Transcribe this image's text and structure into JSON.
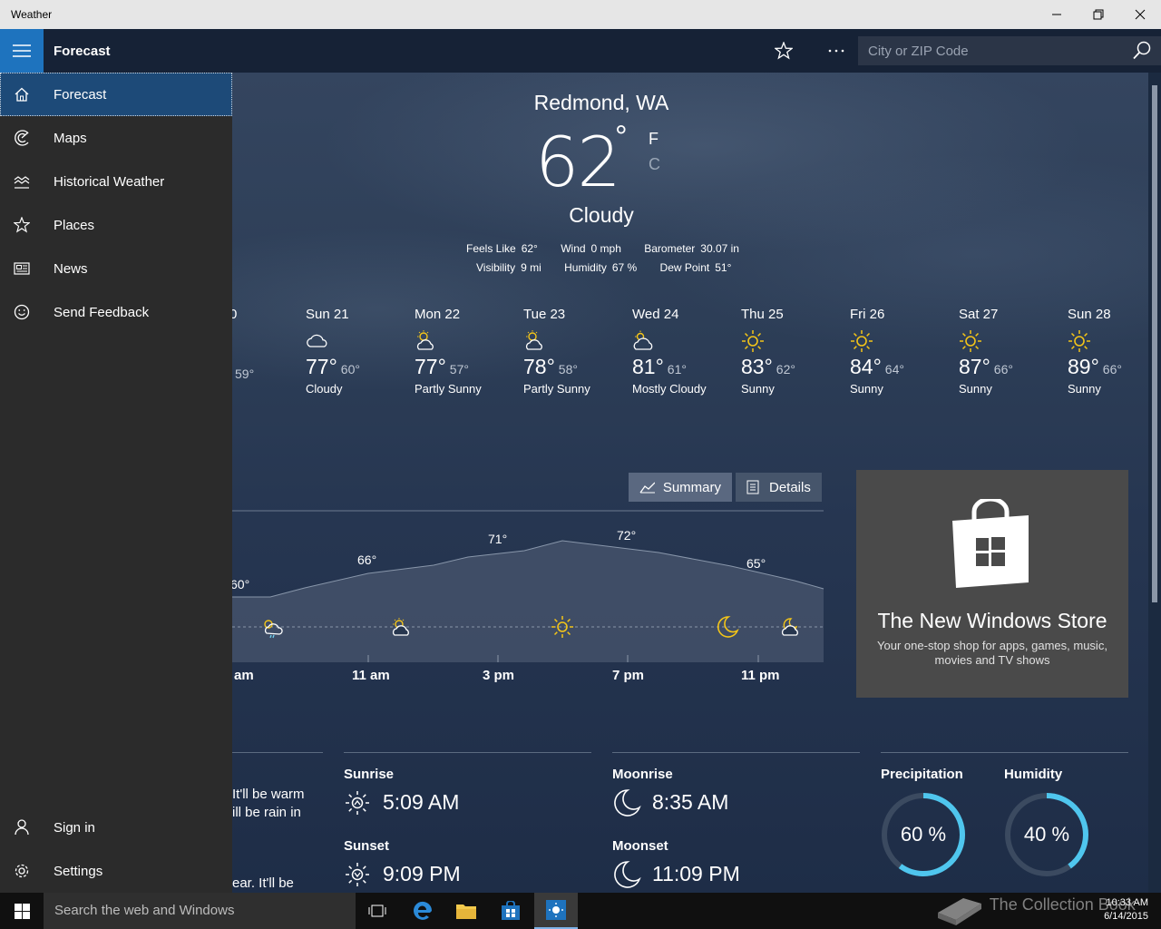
{
  "window": {
    "title": "Weather"
  },
  "header": {
    "title": "Forecast",
    "search_placeholder": "City or ZIP Code"
  },
  "sidebar": {
    "items": [
      {
        "label": "Forecast",
        "icon": "home-icon"
      },
      {
        "label": "Maps",
        "icon": "map-icon"
      },
      {
        "label": "Historical Weather",
        "icon": "chart-icon"
      },
      {
        "label": "Places",
        "icon": "star-icon"
      },
      {
        "label": "News",
        "icon": "news-icon"
      },
      {
        "label": "Send Feedback",
        "icon": "smiley-icon"
      }
    ],
    "bottom": [
      {
        "label": "Sign in",
        "icon": "person-icon"
      },
      {
        "label": "Settings",
        "icon": "gear-icon"
      }
    ]
  },
  "current": {
    "location": "Redmond, WA",
    "temp": "62",
    "degree": "°",
    "unit_f": "F",
    "unit_c": "C",
    "condition": "Cloudy",
    "details_row1": [
      {
        "label": "Feels Like",
        "value": "62°"
      },
      {
        "label": "Wind",
        "value": "0 mph"
      },
      {
        "label": "Barometer",
        "value": "30.07 in"
      }
    ],
    "details_row2": [
      {
        "label": "Visibility",
        "value": "9 mi"
      },
      {
        "label": "Humidity",
        "value": "67 %"
      },
      {
        "label": "Dew Point",
        "value": "51°"
      }
    ]
  },
  "daily": {
    "partial_lo": "59°",
    "partial_name_tail": "0",
    "days": [
      {
        "name": "Sun 21",
        "hi": "77°",
        "lo": "60°",
        "cond": "Cloudy",
        "icon": "cloud-icon"
      },
      {
        "name": "Mon 22",
        "hi": "77°",
        "lo": "57°",
        "cond": "Partly Sunny",
        "icon": "partly-sunny-icon"
      },
      {
        "name": "Tue 23",
        "hi": "78°",
        "lo": "58°",
        "cond": "Partly Sunny",
        "icon": "partly-sunny-icon"
      },
      {
        "name": "Wed 24",
        "hi": "81°",
        "lo": "61°",
        "cond": "Mostly Cloudy",
        "icon": "mostly-cloudy-icon"
      },
      {
        "name": "Thu 25",
        "hi": "83°",
        "lo": "62°",
        "cond": "Sunny",
        "icon": "sun-icon"
      },
      {
        "name": "Fri 26",
        "hi": "84°",
        "lo": "64°",
        "cond": "Sunny",
        "icon": "sun-icon"
      },
      {
        "name": "Sat 27",
        "hi": "87°",
        "lo": "66°",
        "cond": "Sunny",
        "icon": "sun-icon"
      },
      {
        "name": "Sun 28",
        "hi": "89°",
        "lo": "66°",
        "cond": "Sunny",
        "icon": "sun-icon"
      }
    ]
  },
  "hourly": {
    "tabs": {
      "summary": "Summary",
      "details": "Details"
    },
    "temp_labels": [
      "60°",
      "66°",
      "71°",
      "72°",
      "65°"
    ],
    "time_labels": [
      "am",
      "11 am",
      "3 pm",
      "7 pm",
      "11 pm"
    ],
    "icons": [
      "rain-sun-icon",
      "partly-sunny-icon",
      "sun-icon",
      "moon-icon",
      "partly-cloudy-night-icon"
    ]
  },
  "ad": {
    "title": "The New Windows Store",
    "subtitle": "Your one-stop shop for apps, games, music, movies and TV shows"
  },
  "day_summary": {
    "lines": [
      "It'll be warm",
      "ill be rain in",
      "ear. It'll be"
    ]
  },
  "sun": {
    "sunrise_label": "Sunrise",
    "sunrise": "5:09 AM",
    "sunset_label": "Sunset",
    "sunset": "9:09 PM"
  },
  "moon": {
    "moonrise_label": "Moonrise",
    "moonrise": "8:35 AM",
    "moonset_label": "Moonset",
    "moonset": "11:09 PM"
  },
  "gauges": {
    "precip_label": "Precipitation",
    "precip": "60 %",
    "precip_fraction": 0.6,
    "humidity_label": "Humidity",
    "humidity": "40 %",
    "humidity_fraction": 0.4
  },
  "taskbar": {
    "search_placeholder": "Search the web and Windows",
    "time": "10:33 AM",
    "date": "6/14/2015",
    "watermark": "The Collection Book"
  },
  "colors": {
    "accent": "#1e73be",
    "sun": "#f4c518",
    "ring": "#4fc6ee"
  }
}
